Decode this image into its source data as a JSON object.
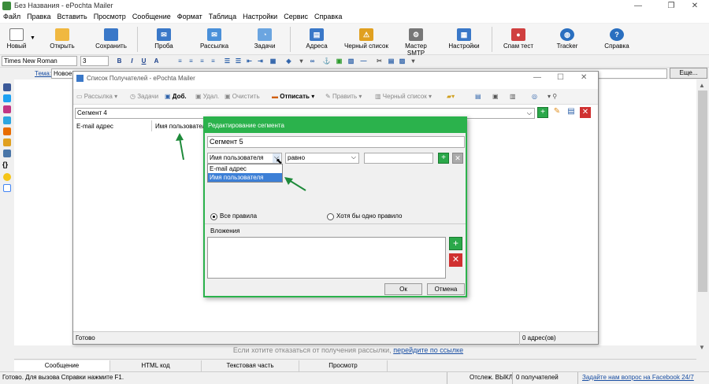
{
  "app": {
    "title": "Без Названия - ePochta Mailer",
    "window_controls": [
      "—",
      "❐",
      "✕"
    ]
  },
  "menu": [
    "Файл",
    "Правка",
    "Вставить",
    "Просмотр",
    "Сообщение",
    "Формат",
    "Таблица",
    "Настройки",
    "Сервис",
    "Справка"
  ],
  "toolbar": {
    "buttons": [
      {
        "label": "Новый",
        "icon": "new-document-icon"
      },
      {
        "label": "Открыть",
        "icon": "folder-icon"
      },
      {
        "label": "Сохранить",
        "icon": "floppy-icon"
      },
      {
        "label": "Проба",
        "icon": "test-icon"
      },
      {
        "label": "Рассылка",
        "icon": "mail-icon"
      },
      {
        "label": "Задачи",
        "icon": "tasks-icon"
      },
      {
        "label": "Адреса",
        "icon": "addresses-icon"
      },
      {
        "label": "Черный список",
        "icon": "warning-icon"
      },
      {
        "label": "Мастер SMTP",
        "icon": "smtp-icon"
      },
      {
        "label": "Настройки",
        "icon": "settings-icon"
      },
      {
        "label": "Спам тест",
        "icon": "spam-icon"
      },
      {
        "label": "Tracker",
        "icon": "globe-icon"
      },
      {
        "label": "Справка",
        "icon": "help-icon"
      }
    ]
  },
  "format": {
    "font": "Times New Roman",
    "size": "3",
    "buttons": [
      "B",
      "I",
      "U",
      "A"
    ]
  },
  "subject": {
    "label": "Тема:",
    "value": "Новое (",
    "more_button": "Еще..."
  },
  "editor": {
    "unsubscribe_text": "Если хотите отказаться от получения рассылки,",
    "unsubscribe_link": "перейдите по ссылке"
  },
  "tabs": [
    "Сообщение",
    "HTML код",
    "Текстовая часть",
    "Просмотр"
  ],
  "status": {
    "left": "Готово. Для вызова Справки нажмите F1.",
    "tracking": "Отслеж. ВЫКЛ",
    "recipients": "0 получателей",
    "facebook_link": "Задайте нам вопрос на Facebook 24/7"
  },
  "recipients_window": {
    "title": "Список Получателей - ePochta Mailer",
    "toolbar": {
      "send": "Рассылка",
      "tasks": "Задачи",
      "add": "Доб.",
      "delete": "Удал.",
      "clear": "Очистить",
      "unsubscribe": "Отписать",
      "edit": "Править",
      "blacklist": "Черный список"
    },
    "segment": "Сегмент 4",
    "columns": [
      "E-mail адрес",
      "Имя пользователя"
    ],
    "status_left": "Готово",
    "status_right": "0 адрес(ов)"
  },
  "segment_dialog": {
    "title": "Редактирование сегмента",
    "name_value": "Сегмент 5",
    "field_selected": "Имя пользователя",
    "field_options": [
      "E-mail адрес",
      "Имя пользователя"
    ],
    "operator": "равно",
    "value": "",
    "radio_all": "Все правила",
    "radio_any": "Хотя бы одно правило",
    "attachments_label": "Вложения",
    "ok": "Ок",
    "cancel": "Отмена"
  },
  "colors": {
    "dialog_accent": "#2bb24c",
    "selection": "#3c7fd6",
    "link": "#1a4fa3"
  }
}
